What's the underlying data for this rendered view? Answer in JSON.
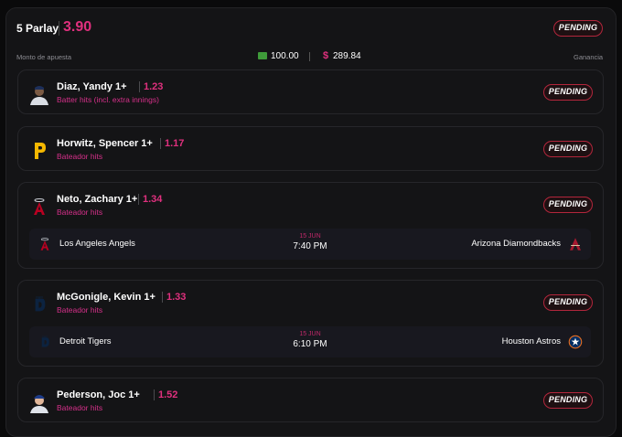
{
  "header": {
    "title": "5 Parlay",
    "odds": "3.90",
    "status": "PENDING",
    "stake_label": "Monto de apuesta",
    "stake_value": "100.00",
    "payout_value": "289.84",
    "payout_currency": "$",
    "gain_label": "Ganancia"
  },
  "legs": [
    {
      "player": "Diaz, Yandy 1+",
      "odds": "1.23",
      "market": "Batter hits (incl. extra innings)",
      "status": "PENDING",
      "icon": "player-headshot-icon"
    },
    {
      "player": "Horwitz, Spencer 1+",
      "odds": "1.17",
      "market": "Bateador hits",
      "status": "PENDING",
      "icon": "pittsburgh-pirates-logo-icon"
    },
    {
      "player": "Neto, Zachary 1+",
      "odds": "1.34",
      "market": "Bateador hits",
      "status": "PENDING",
      "icon": "los-angeles-angels-logo-icon",
      "match": {
        "home": "Los Angeles Angels",
        "away": "Arizona Diamondbacks",
        "date": "15 JUN",
        "time": "7:40 PM"
      }
    },
    {
      "player": "McGonigle, Kevin 1+",
      "odds": "1.33",
      "market": "Bateador hits",
      "status": "PENDING",
      "icon": "detroit-tigers-logo-icon",
      "match": {
        "home": "Detroit Tigers",
        "away": "Houston Astros",
        "date": "15 JUN",
        "time": "6:10 PM"
      }
    },
    {
      "player": "Pederson, Joc 1+",
      "odds": "1.52",
      "market": "Bateador hits",
      "status": "PENDING",
      "icon": "player-headshot-icon"
    }
  ],
  "colors": {
    "accent": "#e0307e",
    "pending_border": "#b3263c",
    "card_bg": "#141416"
  }
}
